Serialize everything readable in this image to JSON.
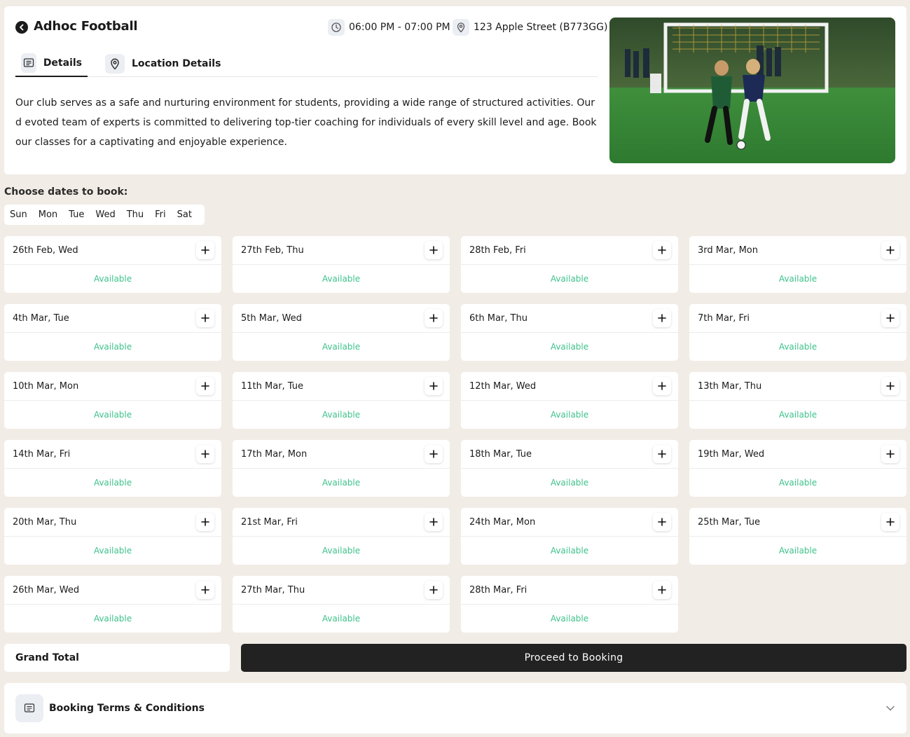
{
  "header": {
    "title": "Adhoc Football",
    "time": "06:00 PM - 07:00 PM",
    "address": "123 Apple Street (B773GG)",
    "tabs": [
      {
        "label": "Details",
        "icon": "details-icon",
        "active": true
      },
      {
        "label": "Location Details",
        "icon": "location-pin-icon",
        "active": false
      }
    ],
    "description": "Our club serves as a safe and nurturing environment for students, providing a wide range of structured activities. Our d evoted team of experts is committed to delivering top-tier coaching for individuals of every skill level and age. Book our classes for a captivating and enjoyable experience."
  },
  "choose": {
    "label": "Choose dates to book:",
    "days": [
      "Sun",
      "Mon",
      "Tue",
      "Wed",
      "Thu",
      "Fri",
      "Sat"
    ]
  },
  "dates": [
    {
      "label": "26th Feb, Wed",
      "status": "Available"
    },
    {
      "label": "27th Feb, Thu",
      "status": "Available"
    },
    {
      "label": "28th Feb, Fri",
      "status": "Available"
    },
    {
      "label": "3rd Mar, Mon",
      "status": "Available"
    },
    {
      "label": "4th Mar, Tue",
      "status": "Available"
    },
    {
      "label": "5th Mar, Wed",
      "status": "Available"
    },
    {
      "label": "6th Mar, Thu",
      "status": "Available"
    },
    {
      "label": "7th Mar, Fri",
      "status": "Available"
    },
    {
      "label": "10th Mar, Mon",
      "status": "Available"
    },
    {
      "label": "11th Mar, Tue",
      "status": "Available"
    },
    {
      "label": "12th Mar, Wed",
      "status": "Available"
    },
    {
      "label": "13th Mar, Thu",
      "status": "Available"
    },
    {
      "label": "14th Mar, Fri",
      "status": "Available"
    },
    {
      "label": "17th Mar, Mon",
      "status": "Available"
    },
    {
      "label": "18th Mar, Tue",
      "status": "Available"
    },
    {
      "label": "19th Mar, Wed",
      "status": "Available"
    },
    {
      "label": "20th Mar, Thu",
      "status": "Available"
    },
    {
      "label": "21st Mar, Fri",
      "status": "Available"
    },
    {
      "label": "24th Mar, Mon",
      "status": "Available"
    },
    {
      "label": "25th Mar, Tue",
      "status": "Available"
    },
    {
      "label": "26th Mar, Wed",
      "status": "Available"
    },
    {
      "label": "27th Mar, Thu",
      "status": "Available"
    },
    {
      "label": "28th Mar, Fri",
      "status": "Available"
    }
  ],
  "footer": {
    "grand_total_label": "Grand Total",
    "proceed_label": "Proceed to Booking",
    "terms_label": "Booking Terms & Conditions"
  },
  "colors": {
    "available": "#3ec28b",
    "background": "#f1ede6",
    "button_dark": "#222222"
  }
}
